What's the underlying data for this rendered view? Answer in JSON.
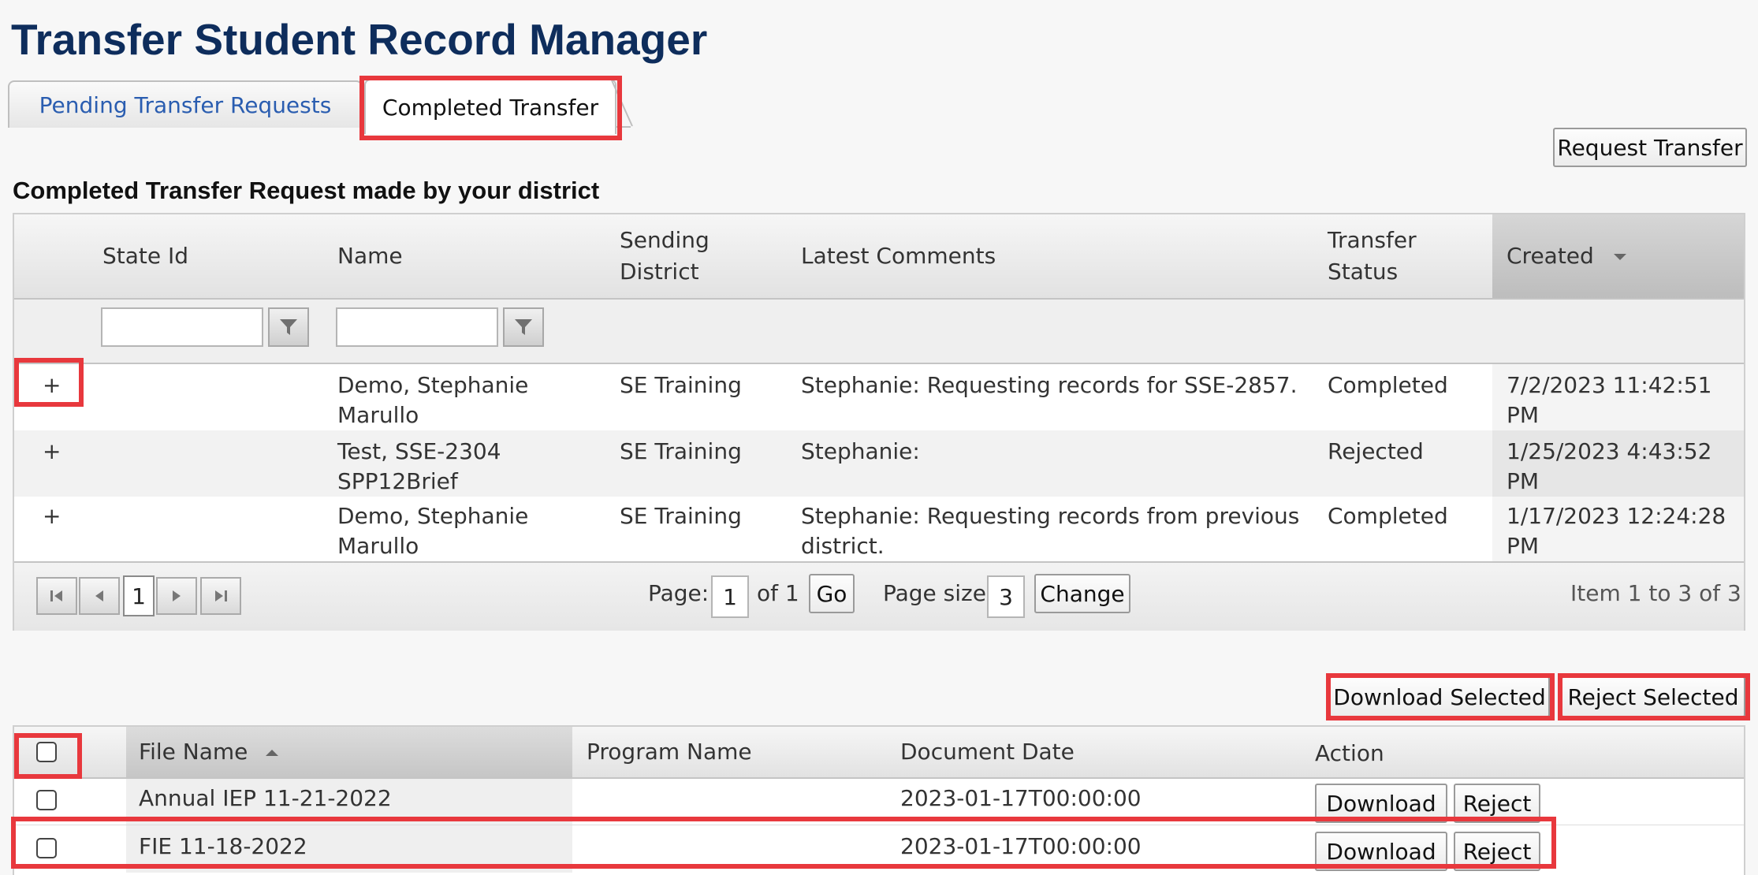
{
  "page": {
    "title": "Transfer Student Record Manager"
  },
  "tabs": {
    "pending": "Pending Transfer Requests",
    "completed": "Completed Transfer"
  },
  "toolbar": {
    "request_transfer": "Request Transfer"
  },
  "section_title": "Completed Transfer Request made by your district",
  "grid1": {
    "headers": {
      "state_id": "State Id",
      "name": "Name",
      "sending_district_l1": "Sending",
      "sending_district_l2": "District",
      "latest_comments": "Latest Comments",
      "transfer_status_l1": "Transfer",
      "transfer_status_l2": "Status",
      "created": "Created"
    },
    "rows": [
      {
        "expand": "+",
        "name_l1": "Demo, Stephanie",
        "name_l2": "Marullo",
        "district": "SE Training",
        "comment_l1": "Stephanie: Requesting records for SSE-2857.",
        "comment_l2": "",
        "status": "Completed",
        "created_l1": "7/2/2023 11:42:51 PM",
        "created_l2": ""
      },
      {
        "expand": "+",
        "name_l1": "Test, SSE-2304",
        "name_l2": "SPP12Brief",
        "district": "SE Training",
        "comment_l1": "Stephanie:",
        "comment_l2": "",
        "status": "Rejected",
        "created_l1": "1/25/2023 4:43:52 PM",
        "created_l2": ""
      },
      {
        "expand": "+",
        "name_l1": "Demo, Stephanie",
        "name_l2": "Marullo",
        "district": "SE Training",
        "comment_l1": "Stephanie: Requesting records from previous",
        "comment_l2": "district.",
        "status": "Completed",
        "created_l1": "1/17/2023 12:24:28",
        "created_l2": "PM"
      }
    ],
    "pager": {
      "current_page_button": "1",
      "page_label": "Page:",
      "page_value": "1",
      "of_label": "of 1",
      "go": "Go",
      "page_size_label": "Page size:",
      "page_size_value": "3",
      "change": "Change",
      "item_info": "Item 1 to 3 of 3"
    }
  },
  "actions": {
    "download_selected": "Download Selected",
    "reject_selected": "Reject Selected"
  },
  "grid2": {
    "headers": {
      "file_name": "File Name",
      "program_name": "Program Name",
      "document_date": "Document Date",
      "action": "Action"
    },
    "rows": [
      {
        "file_name": "Annual IEP 11-21-2022",
        "program_name": "",
        "document_date": "2023-01-17T00:00:00",
        "download": "Download",
        "reject": "Reject"
      },
      {
        "file_name": "FIE 11-18-2022",
        "program_name": "",
        "document_date": "2023-01-17T00:00:00",
        "download": "Download",
        "reject": "Reject"
      }
    ]
  },
  "colors": {
    "title": "#0e2d5c",
    "tab_link": "#2a5db0",
    "highlight": "#e8383d"
  }
}
